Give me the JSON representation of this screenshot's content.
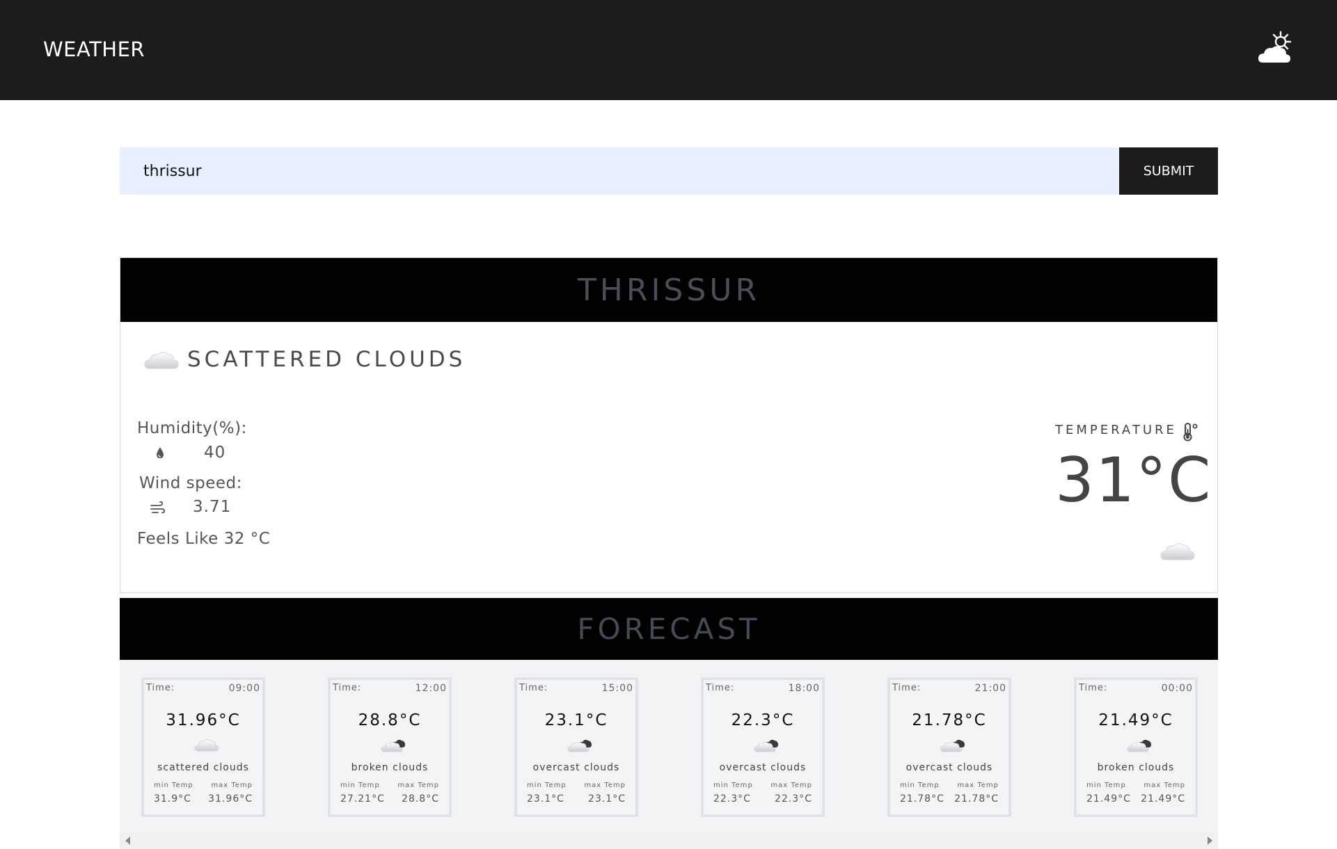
{
  "header": {
    "brand": "WEATHER",
    "logo_icon": "partly-cloudy-day-icon"
  },
  "search": {
    "value": "thrissur",
    "submit_label": "SUBMIT"
  },
  "current": {
    "city": "THRISSUR",
    "condition": "SCATTERED CLOUDS",
    "condition_icon": "cloud-icon",
    "humidity_label": "Humidity(%):",
    "humidity_value": "40",
    "wind_label": "Wind speed:",
    "wind_value": "3.71",
    "feels_like": "Feels Like 32 °C",
    "temperature_label": "TEMPERATURE :",
    "temperature_value": "31°C"
  },
  "forecast": {
    "title": "FORECAST",
    "time_label": "Time:",
    "min_label": "min Temp",
    "max_label": "max Temp",
    "items": [
      {
        "time": "09:00",
        "temp": "31.96°C",
        "desc": "scattered clouds",
        "icon": "cloud-icon",
        "min": "31.9°C",
        "max": "31.96°C"
      },
      {
        "time": "12:00",
        "temp": "28.8°C",
        "desc": "broken clouds",
        "icon": "broken-clouds-icon",
        "min": "27.21°C",
        "max": "28.8°C"
      },
      {
        "time": "15:00",
        "temp": "23.1°C",
        "desc": "overcast clouds",
        "icon": "broken-clouds-icon",
        "min": "23.1°C",
        "max": "23.1°C"
      },
      {
        "time": "18:00",
        "temp": "22.3°C",
        "desc": "overcast clouds",
        "icon": "broken-clouds-icon",
        "min": "22.3°C",
        "max": "22.3°C"
      },
      {
        "time": "21:00",
        "temp": "21.78°C",
        "desc": "overcast clouds",
        "icon": "broken-clouds-icon",
        "min": "21.78°C",
        "max": "21.78°C"
      },
      {
        "time": "00:00",
        "temp": "21.49°C",
        "desc": "broken clouds",
        "icon": "broken-clouds-icon",
        "min": "21.49°C",
        "max": "21.49°C"
      }
    ]
  }
}
